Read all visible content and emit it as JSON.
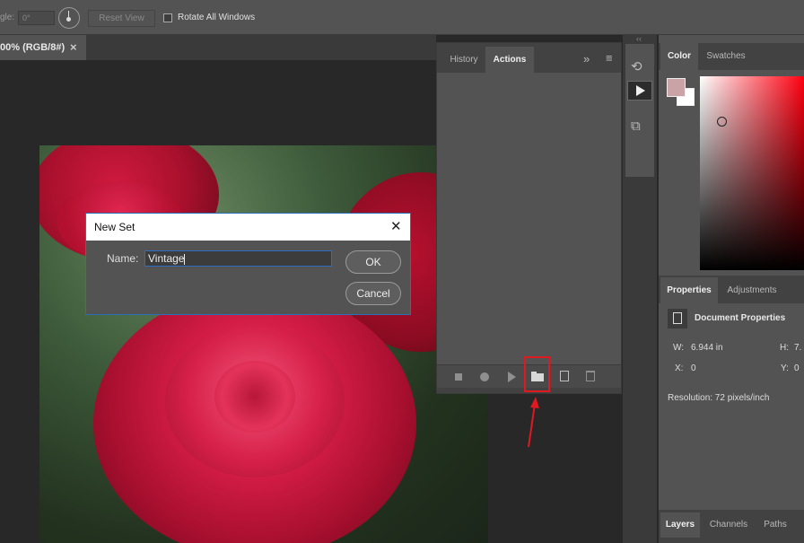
{
  "options_bar": {
    "angle_label": "gle:",
    "angle_value": "0°",
    "reset_view_label": "Reset View",
    "rotate_all_label": "Rotate All Windows"
  },
  "document": {
    "tab_title": "00% (RGB/8#)",
    "close_glyph": "×"
  },
  "history_actions_panel": {
    "tabs": [
      "History",
      "Actions"
    ],
    "active_tab": "Actions",
    "collapse_glyph": "»",
    "menu_glyph": "≡",
    "footer_icons": [
      "stop-icon",
      "record-icon",
      "play-icon",
      "new-set-folder-icon",
      "new-action-icon",
      "trash-icon"
    ]
  },
  "dock_icons": [
    "history-brush-icon",
    "play-icon",
    "transform-icon"
  ],
  "color_panel": {
    "tabs": [
      "Color",
      "Swatches"
    ],
    "active_tab": "Color",
    "foreground_color": "#c9a3a5",
    "background_color": "#ffffff"
  },
  "properties_panel": {
    "tabs": [
      "Properties",
      "Adjustments"
    ],
    "active_tab": "Properties",
    "heading": "Document Properties",
    "w_label": "W:",
    "w_value": "6.944 in",
    "h_label": "H:",
    "h_value": "7.",
    "x_label": "X:",
    "x_value": "0",
    "y_label": "Y:",
    "y_value": "0",
    "resolution": "Resolution: 72 pixels/inch"
  },
  "layers_panel": {
    "tabs": [
      "Layers",
      "Channels",
      "Paths"
    ],
    "active_tab": "Layers"
  },
  "dialog": {
    "title": "New Set",
    "close_glyph": "✕",
    "name_label": "Name:",
    "name_value": "Vintage",
    "ok_label": "OK",
    "cancel_label": "Cancel"
  },
  "annotation": {
    "highlight_color": "#e0181f"
  }
}
